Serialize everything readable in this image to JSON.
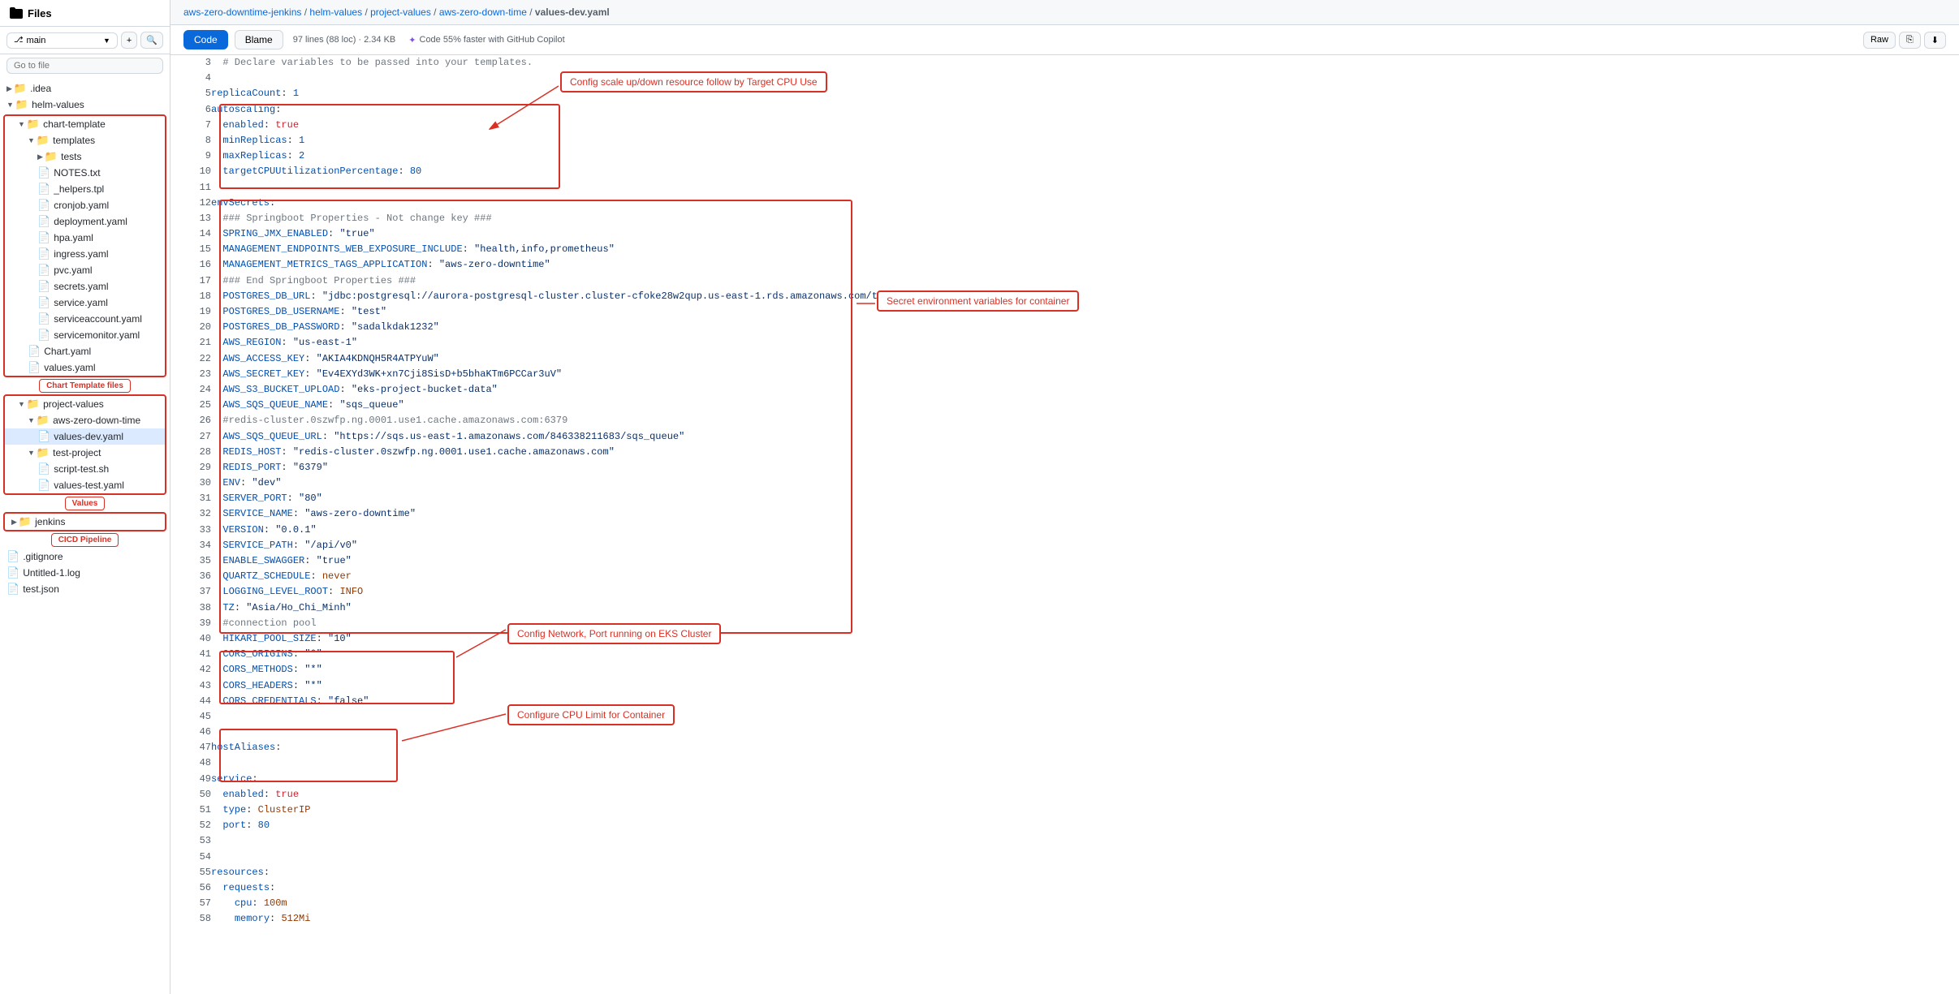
{
  "sidebar": {
    "title": "Files",
    "branch": "main",
    "go_to_file": "Go to file",
    "tree": [
      {
        "id": "idea",
        "label": ".idea",
        "type": "folder",
        "level": 0,
        "open": false
      },
      {
        "id": "helm-values",
        "label": "helm-values",
        "type": "folder",
        "level": 0,
        "open": true
      },
      {
        "id": "chart-template",
        "label": "chart-template",
        "type": "folder",
        "level": 1,
        "open": true
      },
      {
        "id": "templates",
        "label": "templates",
        "type": "folder",
        "level": 2,
        "open": true
      },
      {
        "id": "tests",
        "label": "tests",
        "type": "folder",
        "level": 3,
        "open": false
      },
      {
        "id": "NOTES.txt",
        "label": "NOTES.txt",
        "type": "file",
        "level": 3
      },
      {
        "id": "_helpers.tpl",
        "label": "_helpers.tpl",
        "type": "file",
        "level": 3
      },
      {
        "id": "cronjob.yaml",
        "label": "cronjob.yaml",
        "type": "file",
        "level": 3
      },
      {
        "id": "deployment.yaml",
        "label": "deployment.yaml",
        "type": "file",
        "level": 3
      },
      {
        "id": "hpa.yaml",
        "label": "hpa.yaml",
        "type": "file",
        "level": 3
      },
      {
        "id": "ingress.yaml",
        "label": "ingress.yaml",
        "type": "file",
        "level": 3
      },
      {
        "id": "pvc.yaml",
        "label": "pvc.yaml",
        "type": "file",
        "level": 3
      },
      {
        "id": "secrets.yaml",
        "label": "secrets.yaml",
        "type": "file",
        "level": 3
      },
      {
        "id": "service.yaml",
        "label": "service.yaml",
        "type": "file",
        "level": 3
      },
      {
        "id": "serviceaccount.yaml",
        "label": "serviceaccount.yaml",
        "type": "file",
        "level": 3
      },
      {
        "id": "servicemonitor.yaml",
        "label": "servicemonitor.yaml",
        "type": "file",
        "level": 3
      },
      {
        "id": "Chart.yaml",
        "label": "Chart.yaml",
        "type": "file",
        "level": 2
      },
      {
        "id": "values.yaml",
        "label": "values.yaml",
        "type": "file",
        "level": 2
      },
      {
        "id": "project-values",
        "label": "project-values",
        "type": "folder",
        "level": 1,
        "open": true
      },
      {
        "id": "aws-zero-down-time",
        "label": "aws-zero-down-time",
        "type": "folder",
        "level": 2,
        "open": true
      },
      {
        "id": "values-dev.yaml",
        "label": "values-dev.yaml",
        "type": "file",
        "level": 3,
        "selected": true
      },
      {
        "id": "test-project",
        "label": "test-project",
        "type": "folder",
        "level": 2,
        "open": true
      },
      {
        "id": "script-test.sh",
        "label": "script-test.sh",
        "type": "file",
        "level": 3
      },
      {
        "id": "values-test.yaml",
        "label": "values-test.yaml",
        "type": "file",
        "level": 3
      },
      {
        "id": "jenkins",
        "label": "jenkins",
        "type": "folder",
        "level": 0,
        "open": false
      },
      {
        "id": "gitignore",
        "label": ".gitignore",
        "type": "file",
        "level": 0
      },
      {
        "id": "Untitled-1.log",
        "label": "Untitled-1.log",
        "type": "file",
        "level": 0
      },
      {
        "id": "test.json",
        "label": "test.json",
        "type": "file",
        "level": 0
      }
    ]
  },
  "breadcrumb": {
    "parts": [
      "aws-zero-downtime-jenkins",
      "helm-values",
      "project-values",
      "aws-zero-down-time",
      "values-dev.yaml"
    ]
  },
  "toolbar": {
    "code_label": "Code",
    "blame_label": "Blame",
    "meta": "97 lines (88 loc) · 2.34 KB",
    "copilot": "Code 55% faster with GitHub Copilot",
    "raw_label": "Raw"
  },
  "code_lines": [
    {
      "num": 3,
      "text": "  # Declare variables to be passed into your templates."
    },
    {
      "num": 4,
      "text": ""
    },
    {
      "num": 5,
      "text": "replicaCount: 1"
    },
    {
      "num": 6,
      "text": "autoscaling:"
    },
    {
      "num": 7,
      "text": "  enabled: true"
    },
    {
      "num": 8,
      "text": "  minReplicas: 1"
    },
    {
      "num": 9,
      "text": "  maxReplicas: 2"
    },
    {
      "num": 10,
      "text": "  targetCPUUtilizationPercentage: 80"
    },
    {
      "num": 11,
      "text": ""
    },
    {
      "num": 12,
      "text": "envSecrets:"
    },
    {
      "num": 13,
      "text": "  ### Springboot Properties - Not change key ###"
    },
    {
      "num": 14,
      "text": "  SPRING_JMX_ENABLED: \"true\""
    },
    {
      "num": 15,
      "text": "  MANAGEMENT_ENDPOINTS_WEB_EXPOSURE_INCLUDE: \"health,info,prometheus\""
    },
    {
      "num": 16,
      "text": "  MANAGEMENT_METRICS_TAGS_APPLICATION: \"aws-zero-downtime\""
    },
    {
      "num": 17,
      "text": "  ### End Springboot Properties ###"
    },
    {
      "num": 18,
      "text": "  POSTGRES_DB_URL: \"jdbc:postgresql://aurora-postgresql-cluster.cluster-cfoke28w2qup.us-east-1.rds.amazonaws.com/test\""
    },
    {
      "num": 19,
      "text": "  POSTGRES_DB_USERNAME: \"test\""
    },
    {
      "num": 20,
      "text": "  POSTGRES_DB_PASSWORD: \"sadalkdak1232\""
    },
    {
      "num": 21,
      "text": "  AWS_REGION: \"us-east-1\""
    },
    {
      "num": 22,
      "text": "  AWS_ACCESS_KEY: \"AKIA4KDNQH5R4ATPYuW\""
    },
    {
      "num": 23,
      "text": "  AWS_SECRET_KEY: \"Ev4EXYd3WK+xn7Cji8SisD+b5bhaKTm6PCCar3uV\""
    },
    {
      "num": 24,
      "text": "  AWS_S3_BUCKET_UPLOAD: \"eks-project-bucket-data\""
    },
    {
      "num": 25,
      "text": "  AWS_SQS_QUEUE_NAME: \"sqs_queue\""
    },
    {
      "num": 26,
      "text": "  #redis-cluster.0szwfp.ng.0001.use1.cache.amazonaws.com:6379"
    },
    {
      "num": 27,
      "text": "  AWS_SQS_QUEUE_URL: \"https://sqs.us-east-1.amazonaws.com/846338211683/sqs_queue\""
    },
    {
      "num": 28,
      "text": "  REDIS_HOST: \"redis-cluster.0szwfp.ng.0001.use1.cache.amazonaws.com\""
    },
    {
      "num": 29,
      "text": "  REDIS_PORT: \"6379\""
    },
    {
      "num": 30,
      "text": "  ENV: \"dev\""
    },
    {
      "num": 31,
      "text": "  SERVER_PORT: \"80\""
    },
    {
      "num": 32,
      "text": "  SERVICE_NAME: \"aws-zero-downtime\""
    },
    {
      "num": 33,
      "text": "  VERSION: \"0.0.1\""
    },
    {
      "num": 34,
      "text": "  SERVICE_PATH: \"/api/v0\""
    },
    {
      "num": 35,
      "text": "  ENABLE_SWAGGER: \"true\""
    },
    {
      "num": 36,
      "text": "  QUARTZ_SCHEDULE: never"
    },
    {
      "num": 37,
      "text": "  LOGGING_LEVEL_ROOT: INFO"
    },
    {
      "num": 38,
      "text": "  TZ: \"Asia/Ho_Chi_Minh\""
    },
    {
      "num": 39,
      "text": "  #connection pool"
    },
    {
      "num": 40,
      "text": "  HIKARI_POOL_SIZE: \"10\""
    },
    {
      "num": 41,
      "text": "  CORS_ORIGINS: \"*\""
    },
    {
      "num": 42,
      "text": "  CORS_METHODS: \"*\""
    },
    {
      "num": 43,
      "text": "  CORS_HEADERS: \"*\""
    },
    {
      "num": 44,
      "text": "  CORS_CREDENTIALS: \"false\""
    },
    {
      "num": 45,
      "text": ""
    },
    {
      "num": 46,
      "text": ""
    },
    {
      "num": 47,
      "text": "hostAliases:"
    },
    {
      "num": 48,
      "text": ""
    },
    {
      "num": 49,
      "text": "service:"
    },
    {
      "num": 50,
      "text": "  enabled: true"
    },
    {
      "num": 51,
      "text": "  type: ClusterIP"
    },
    {
      "num": 52,
      "text": "  port: 80"
    },
    {
      "num": 53,
      "text": ""
    },
    {
      "num": 54,
      "text": ""
    },
    {
      "num": 55,
      "text": "resources:"
    },
    {
      "num": 56,
      "text": "  requests:"
    },
    {
      "num": 57,
      "text": "    cpu: 100m"
    },
    {
      "num": 58,
      "text": "    memory: 512Mi"
    }
  ],
  "annotations": {
    "callout1": "Config scale up/down resource follow by Target CPU Use",
    "callout2": "Secret environment variables for container",
    "callout3": "Config Network, Port running on EKS Cluster",
    "callout4": "Configure CPU Limit for Container",
    "sidebar_label1": "Chart Template\nfiles",
    "sidebar_label2": "Values",
    "sidebar_label3": "CICD Pipeline"
  }
}
